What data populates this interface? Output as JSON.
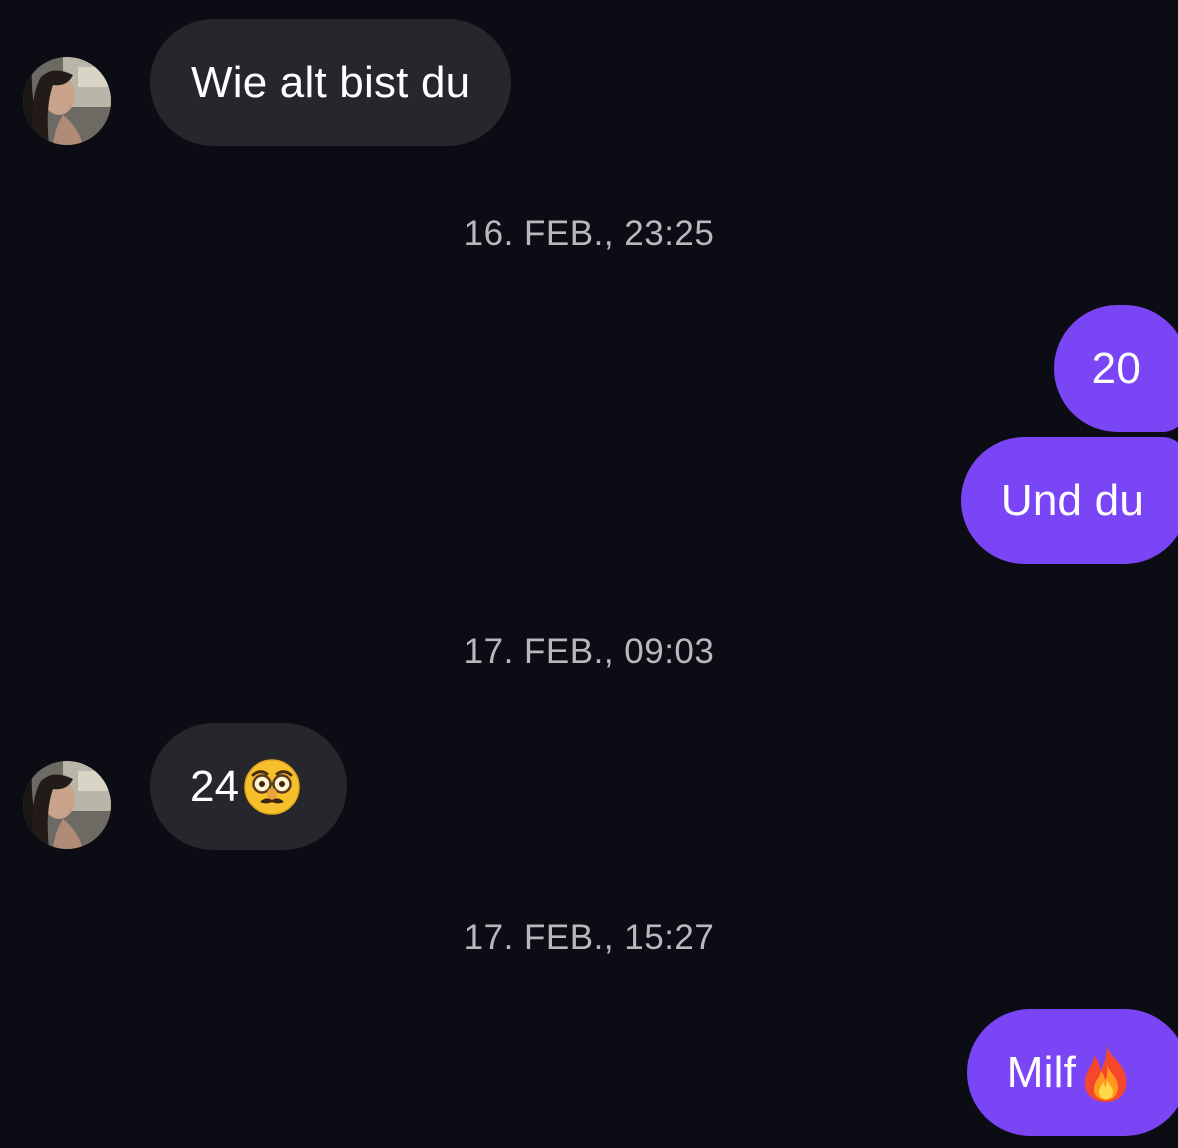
{
  "conversation": {
    "messages": [
      {
        "sender": "other",
        "text": "Wie alt bist du",
        "emoji": ""
      },
      {
        "timestamp": "16. FEB., 23:25"
      },
      {
        "sender": "me",
        "text": "20",
        "emoji": ""
      },
      {
        "sender": "me",
        "text": "Und du",
        "emoji": ""
      },
      {
        "timestamp": "17. FEB., 09:03"
      },
      {
        "sender": "other",
        "text": "24",
        "emoji": "disguised-face"
      },
      {
        "timestamp": "17. FEB., 15:27"
      },
      {
        "sender": "me",
        "text": "Milf",
        "emoji": "fire"
      }
    ]
  },
  "colors": {
    "background": "#0c0d14",
    "incoming_bubble": "#26272c",
    "outgoing_bubble": "#7a45f5",
    "timestamp_text": "#b8b8be"
  }
}
